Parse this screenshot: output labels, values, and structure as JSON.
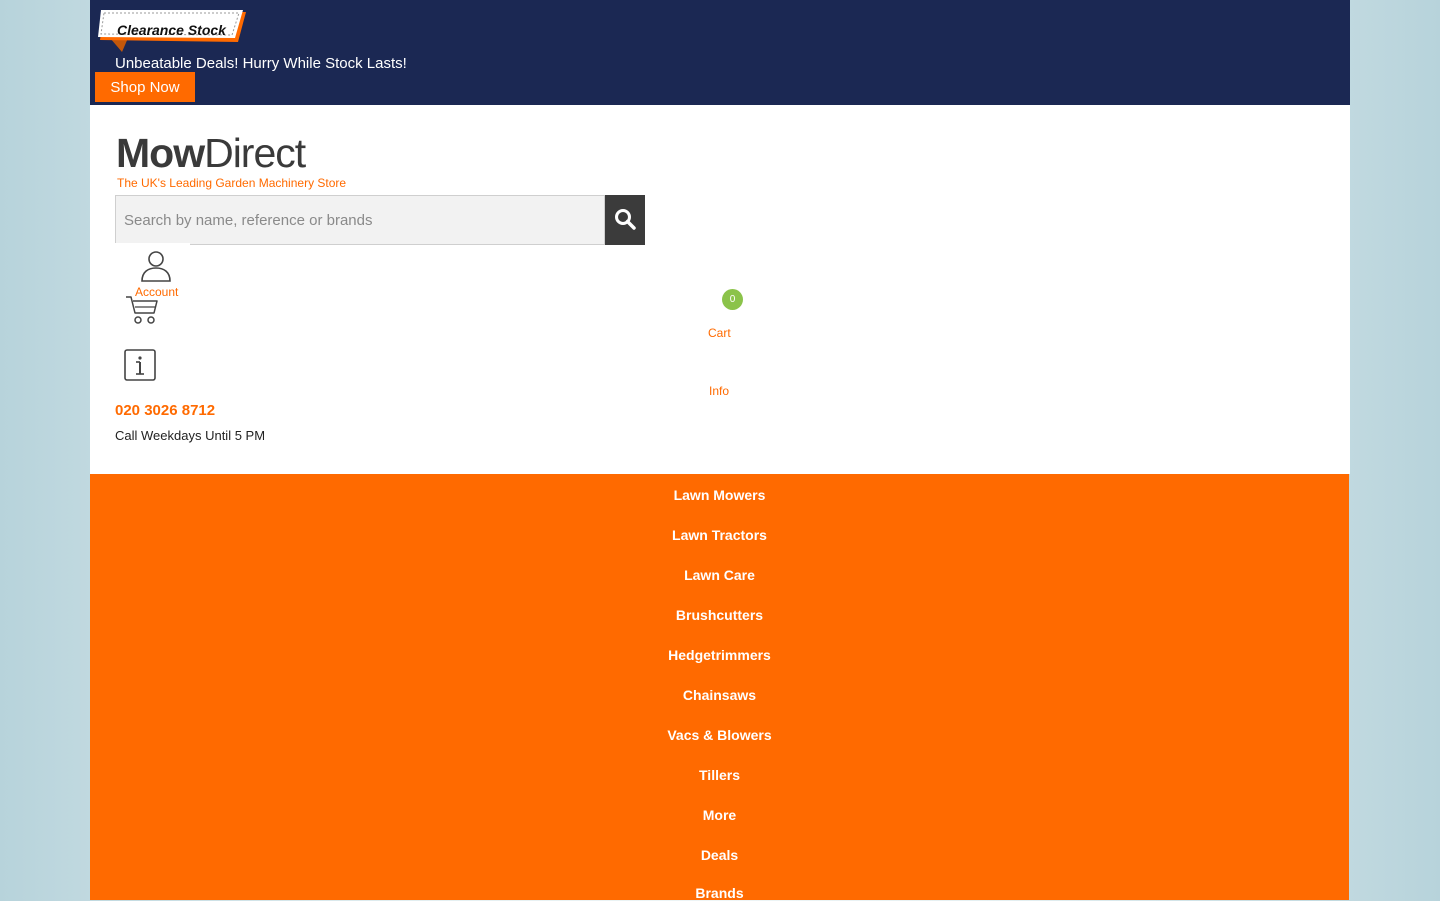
{
  "banner": {
    "tag": "Clearance Stock",
    "headline": "Unbeatable Deals! Hurry While Stock Lasts!",
    "cta": "Shop Now"
  },
  "brand": {
    "name_bold": "Mow",
    "name_rest": "Direct",
    "tagline": "The UK's Leading Garden Machinery Store"
  },
  "search": {
    "placeholder": "Search by name, reference or brands"
  },
  "account": {
    "label": "Account"
  },
  "cart": {
    "label": "Cart",
    "count": "0"
  },
  "info": {
    "label": "Info"
  },
  "contact": {
    "phone": "020 3026 8712",
    "hours": "Call Weekdays Until 5 PM"
  },
  "nav": {
    "items": [
      "Lawn Mowers",
      "Lawn Tractors",
      "Lawn Care",
      "Brushcutters",
      "Hedgetrimmers",
      "Chainsaws",
      "Vacs & Blowers",
      "Tillers",
      "More",
      "Deals",
      "Brands"
    ]
  },
  "colors": {
    "banner_bg": "#1b2853",
    "accent": "#ff6a00",
    "badge": "#8bc34a"
  }
}
